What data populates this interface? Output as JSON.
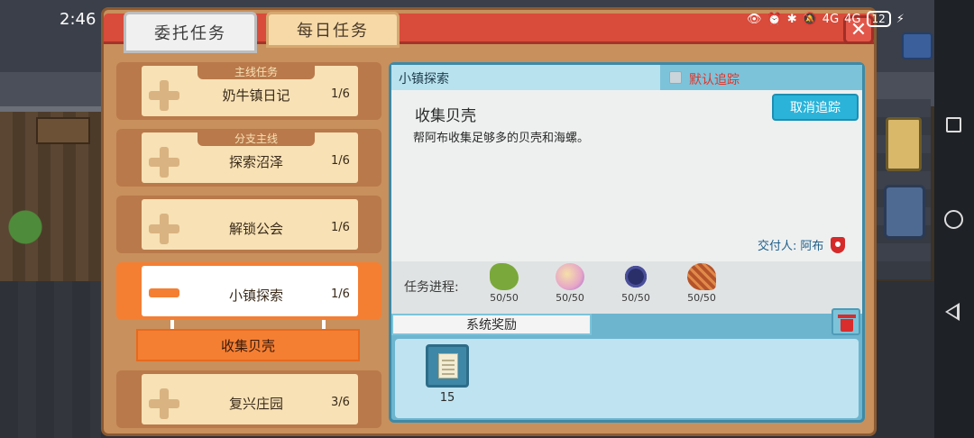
{
  "status": {
    "time": "2:46",
    "battery": "12",
    "signal1": "4G",
    "signal2": "4G"
  },
  "tabs": [
    {
      "label": "委托任务",
      "active": true
    },
    {
      "label": "每日任务",
      "active": false
    }
  ],
  "quests": [
    {
      "category": "主线任务",
      "name": "奶牛镇日记",
      "count": "1/6"
    },
    {
      "category": "分支主线",
      "name": "探索沼泽",
      "count": "1/6"
    },
    {
      "category": "",
      "name": "解锁公会",
      "count": "1/6"
    },
    {
      "category": "",
      "name": "小镇探索",
      "count": "1/6",
      "selected": true
    },
    {
      "category": "",
      "name": "复兴庄园",
      "count": "3/6"
    }
  ],
  "sub_quest": "收集贝壳",
  "detail": {
    "header_title": "小镇探索",
    "default_track_label": "默认追踪",
    "quest_title": "收集贝壳",
    "description": "帮阿布收集足够多的贝壳和海螺。",
    "cancel_track_label": "取消追踪",
    "giver_label": "交付人:",
    "giver_name": "阿布",
    "progress_label": "任务进程:",
    "items": [
      {
        "icon": "green-shell-icon",
        "count": "50/50",
        "color": "#7aa83a"
      },
      {
        "icon": "conch-icon",
        "count": "50/50",
        "color": "#e6a6c8"
      },
      {
        "icon": "sea-urchin-icon",
        "count": "50/50",
        "color": "#2a2f6a"
      },
      {
        "icon": "scallop-icon",
        "count": "50/50",
        "color": "#b5542a"
      }
    ],
    "reward_tab_label": "系统奖励",
    "reward": {
      "icon": "note-paper-icon",
      "count": "15"
    }
  },
  "colors": {
    "accent_orange": "#f47f33",
    "accent_blue": "#2bb3d9",
    "frame_brown": "#c8905c",
    "tracking_red": "#e0352a"
  }
}
